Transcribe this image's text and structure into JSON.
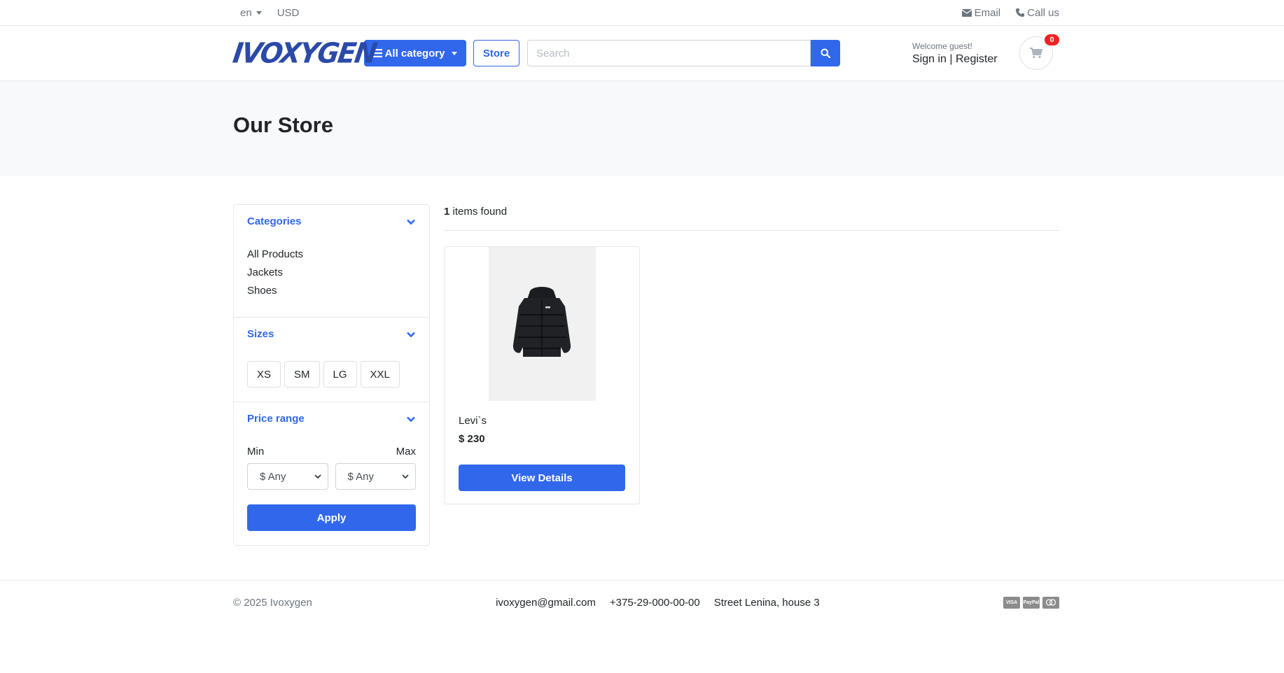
{
  "topbar": {
    "language": "en",
    "currency": "USD",
    "email_label": "Email",
    "call_label": "Call us"
  },
  "header": {
    "logo_text": "IVOXYGEN",
    "category_button": "All category",
    "store_button": "Store",
    "search_placeholder": "Search",
    "welcome": "Welcome guest!",
    "sign_in": "Sign in",
    "separator": "|",
    "register": "Register",
    "cart_count": "0"
  },
  "page_title": "Our Store",
  "sidebar": {
    "categories_title": "Categories",
    "categories": [
      "All Products",
      "Jackets",
      "Shoes"
    ],
    "sizes_title": "Sizes",
    "sizes": [
      "XS",
      "SM",
      "LG",
      "XXL"
    ],
    "price_title": "Price range",
    "min_label": "Min",
    "max_label": "Max",
    "min_value": "$ Any",
    "max_value": "$ Any",
    "apply_button": "Apply"
  },
  "results": {
    "count": "1",
    "count_suffix": " items found"
  },
  "products": [
    {
      "name": "Levi`s",
      "price": "$ 230",
      "button": "View Details"
    }
  ],
  "footer": {
    "copyright": "© 2025 Ivoxygen",
    "email": "ivoxygen@gmail.com",
    "phone": "+375-29-000-00-00",
    "address": "Street Lenina, house 3",
    "payment_icons": [
      "visa-icon",
      "paypal-icon",
      "mastercard-icon"
    ]
  },
  "colors": {
    "primary": "#3167eb",
    "logo": "#2b4aa8",
    "badge": "#ee2222",
    "band_bg": "#f8f9fa"
  }
}
